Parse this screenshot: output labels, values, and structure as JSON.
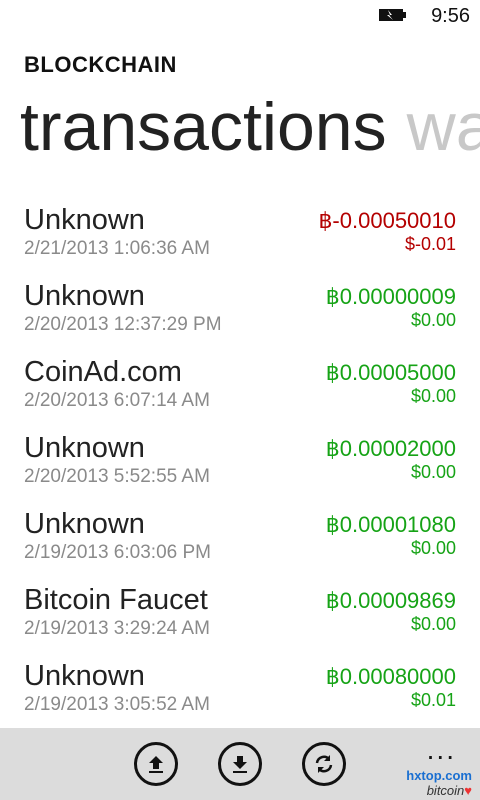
{
  "status": {
    "time": "9:56"
  },
  "header": {
    "app_name": "BLOCKCHAIN",
    "pivot_active": "transactions",
    "pivot_next": "wa"
  },
  "transactions": [
    {
      "name": "Unknown",
      "date": "2/21/2013 1:06:36 AM",
      "btc": "฿-0.00050010",
      "usd": "$-0.01",
      "direction": "negative"
    },
    {
      "name": "Unknown",
      "date": "2/20/2013 12:37:29 PM",
      "btc": "฿0.00000009",
      "usd": "$0.00",
      "direction": "positive"
    },
    {
      "name": "CoinAd.com",
      "date": "2/20/2013 6:07:14 AM",
      "btc": "฿0.00005000",
      "usd": "$0.00",
      "direction": "positive"
    },
    {
      "name": "Unknown",
      "date": "2/20/2013 5:52:55 AM",
      "btc": "฿0.00002000",
      "usd": "$0.00",
      "direction": "positive"
    },
    {
      "name": "Unknown",
      "date": "2/19/2013 6:03:06 PM",
      "btc": "฿0.00001080",
      "usd": "$0.00",
      "direction": "positive"
    },
    {
      "name": "Bitcoin Faucet",
      "date": "2/19/2013 3:29:24 AM",
      "btc": "฿0.00009869",
      "usd": "$0.00",
      "direction": "positive"
    },
    {
      "name": "Unknown",
      "date": "2/19/2013 3:05:52 AM",
      "btc": "฿0.00080000",
      "usd": "$0.01",
      "direction": "positive"
    }
  ],
  "app_bar": {
    "buttons": [
      {
        "name": "send-icon"
      },
      {
        "name": "receive-icon"
      },
      {
        "name": "refresh-icon"
      }
    ],
    "more": "..."
  },
  "colors": {
    "negative": "#b40000",
    "positive": "#16a316",
    "app_bar_bg": "#dcdcdc"
  },
  "watermark": {
    "site": "hxtop.com",
    "word": "bitcoin",
    "heart": "♥"
  }
}
